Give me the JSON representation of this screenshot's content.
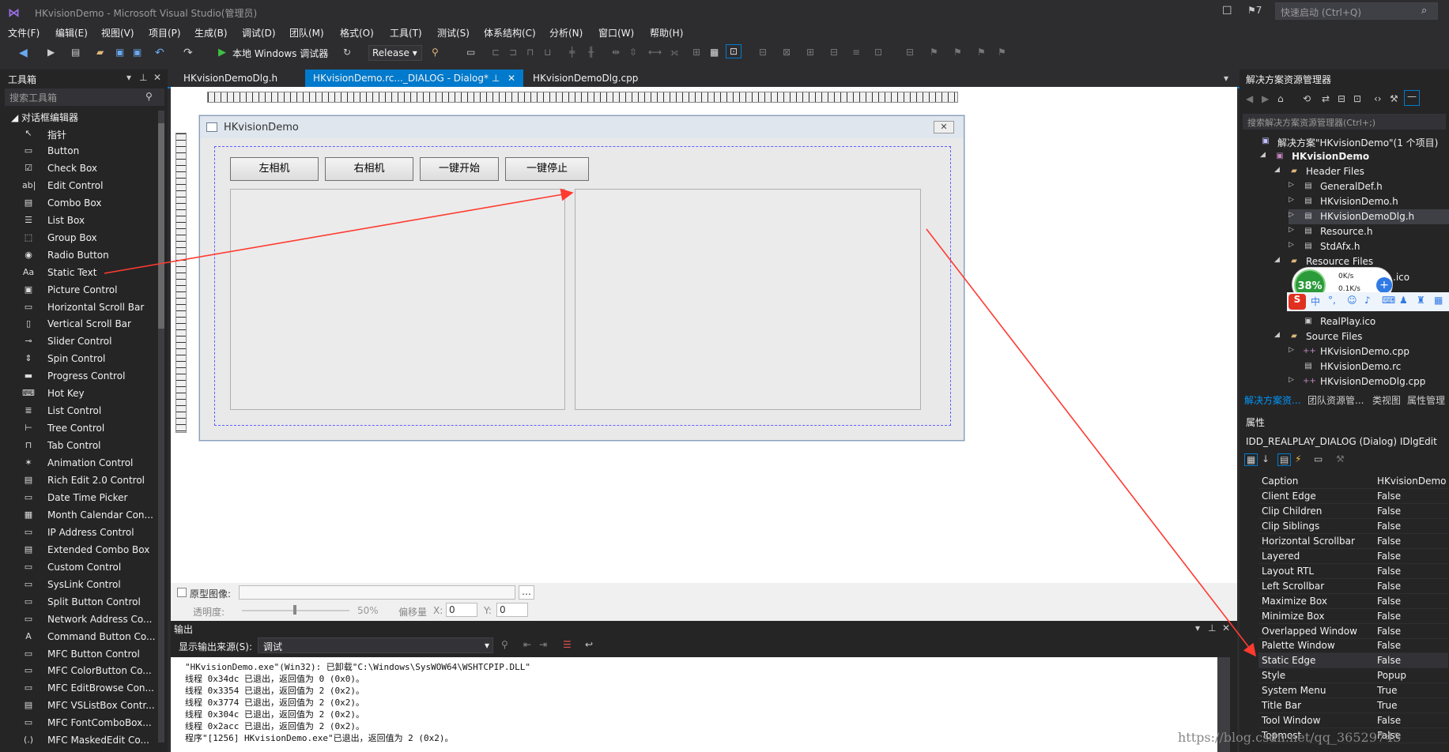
{
  "window": {
    "title": "HKvisionDemo - Microsoft Visual Studio(管理员)",
    "quick_launch": "快速启动 (Ctrl+Q)",
    "notif_count": "7"
  },
  "menu": [
    "文件(F)",
    "编辑(E)",
    "视图(V)",
    "项目(P)",
    "生成(B)",
    "调试(D)",
    "团队(M)",
    "格式(O)",
    "工具(T)",
    "测试(S)",
    "体系结构(C)",
    "分析(N)",
    "窗口(W)",
    "帮助(H)"
  ],
  "toolbar": {
    "debugger": "本地 Windows 调试器",
    "config": "Release"
  },
  "toolbox": {
    "title": "工具箱",
    "search_placeholder": "搜索工具箱",
    "group": "对话框编辑器",
    "items": [
      {
        "label": "指针",
        "icon": "pointer-icon",
        "glyph": "↖"
      },
      {
        "label": "Button",
        "icon": "button-icon",
        "glyph": "▭"
      },
      {
        "label": "Check Box",
        "icon": "checkbox-icon",
        "glyph": "☑"
      },
      {
        "label": "Edit Control",
        "icon": "edit-control-icon",
        "glyph": "ab|"
      },
      {
        "label": "Combo Box",
        "icon": "combobox-icon",
        "glyph": "▤"
      },
      {
        "label": "List Box",
        "icon": "listbox-icon",
        "glyph": "☰"
      },
      {
        "label": "Group Box",
        "icon": "groupbox-icon",
        "glyph": "⬚"
      },
      {
        "label": "Radio Button",
        "icon": "radio-icon",
        "glyph": "◉"
      },
      {
        "label": "Static Text",
        "icon": "static-text-icon",
        "glyph": "Aa"
      },
      {
        "label": "Picture Control",
        "icon": "picture-icon",
        "glyph": "▣"
      },
      {
        "label": "Horizontal Scroll Bar",
        "icon": "hscroll-icon",
        "glyph": "▭"
      },
      {
        "label": "Vertical Scroll Bar",
        "icon": "vscroll-icon",
        "glyph": "▯"
      },
      {
        "label": "Slider Control",
        "icon": "slider-icon",
        "glyph": "⊸"
      },
      {
        "label": "Spin Control",
        "icon": "spin-icon",
        "glyph": "⇕"
      },
      {
        "label": "Progress Control",
        "icon": "progress-icon",
        "glyph": "▬"
      },
      {
        "label": "Hot Key",
        "icon": "hotkey-icon",
        "glyph": "⌨"
      },
      {
        "label": "List Control",
        "icon": "listctrl-icon",
        "glyph": "≣"
      },
      {
        "label": "Tree Control",
        "icon": "tree-icon",
        "glyph": "⊢"
      },
      {
        "label": "Tab Control",
        "icon": "tab-icon",
        "glyph": "⊓"
      },
      {
        "label": "Animation Control",
        "icon": "animation-icon",
        "glyph": "✶"
      },
      {
        "label": "Rich Edit 2.0 Control",
        "icon": "richedit-icon",
        "glyph": "▤"
      },
      {
        "label": "Date Time Picker",
        "icon": "datetime-icon",
        "glyph": "▭"
      },
      {
        "label": "Month Calendar Con...",
        "icon": "calendar-icon",
        "glyph": "▦"
      },
      {
        "label": "IP Address Control",
        "icon": "ipaddr-icon",
        "glyph": "▭"
      },
      {
        "label": "Extended Combo Box",
        "icon": "extcombo-icon",
        "glyph": "▤"
      },
      {
        "label": "Custom Control",
        "icon": "custom-icon",
        "glyph": "▭"
      },
      {
        "label": "SysLink Control",
        "icon": "syslink-icon",
        "glyph": "▭"
      },
      {
        "label": "Split Button Control",
        "icon": "splitbutton-icon",
        "glyph": "▭"
      },
      {
        "label": "Network Address Co...",
        "icon": "netaddr-icon",
        "glyph": "▭"
      },
      {
        "label": "Command Button Co...",
        "icon": "command-icon",
        "glyph": "A"
      },
      {
        "label": "MFC Button Control",
        "icon": "mfcbutton-icon",
        "glyph": "▭"
      },
      {
        "label": "MFC ColorButton Co...",
        "icon": "colorbutton-icon",
        "glyph": "▭"
      },
      {
        "label": "MFC EditBrowse Con...",
        "icon": "editbrowse-icon",
        "glyph": "▭"
      },
      {
        "label": "MFC VSListBox Contr...",
        "icon": "vslistbox-icon",
        "glyph": "▤"
      },
      {
        "label": "MFC FontComboBox...",
        "icon": "fontcombo-icon",
        "glyph": "▭"
      },
      {
        "label": "MFC MaskedEdit Co...",
        "icon": "maskededit-icon",
        "glyph": "(.)"
      }
    ]
  },
  "tabs": [
    "HKvisionDemoDlg.h",
    "HKvisionDemo.rc..._DIALOG - Dialog*",
    "HKvisionDemoDlg.cpp"
  ],
  "dialog": {
    "caption": "HKvisionDemo",
    "buttons": [
      "左相机",
      "右相机",
      "一键开始",
      "一键停止"
    ]
  },
  "editbar": {
    "proto_label": "原型图像:",
    "opacity_label": "透明度:",
    "opacity_value": "50%",
    "offset_label": "偏移量",
    "x_label": "X:",
    "x_value": "0",
    "y_label": "Y:",
    "y_value": "0"
  },
  "output": {
    "title": "输出",
    "source_label": "显示输出来源(S):",
    "source_value": "调试",
    "lines": [
      "\"HKvisionDemo.exe\"(Win32): 已卸载\"C:\\Windows\\SysWOW64\\WSHTCPIP.DLL\"",
      "线程 0x34dc 已退出，返回值为 0 (0x0)。",
      "线程 0x3354 已退出，返回值为 2 (0x2)。",
      "线程 0x3774 已退出，返回值为 2 (0x2)。",
      "线程 0x304c 已退出，返回值为 2 (0x2)。",
      "线程 0x2acc 已退出，返回值为 2 (0x2)。",
      "程序\"[1256] HKvisionDemo.exe\"已退出，返回值为 2 (0x2)。"
    ]
  },
  "solution_explorer": {
    "title": "解决方案资源管理器",
    "search_placeholder": "搜索解决方案资源管理器(Ctrl+;)",
    "tree": [
      {
        "label": "解决方案\"HKvisionDemo\"(1 个项目)",
        "indent": 0,
        "arrow": "",
        "icon": "solution-icon",
        "glyph": "▣",
        "color": "#c0c0ff"
      },
      {
        "label": "HKvisionDemo",
        "indent": 1,
        "arrow": "◢",
        "icon": "project-icon",
        "glyph": "▣",
        "color": "#c586c0"
      },
      {
        "label": "Header Files",
        "indent": 2,
        "arrow": "◢",
        "icon": "folder-icon",
        "glyph": "▰",
        "color": "#dcb67a"
      },
      {
        "label": "GeneralDef.h",
        "indent": 3,
        "arrow": "▷",
        "icon": "header-file-icon",
        "glyph": "▤",
        "color": "#ccc"
      },
      {
        "label": "HKvisionDemo.h",
        "indent": 3,
        "arrow": "▷",
        "icon": "header-file-icon",
        "glyph": "▤",
        "color": "#ccc"
      },
      {
        "label": "HKvisionDemoDlg.h",
        "indent": 3,
        "arrow": "▷",
        "icon": "header-file-icon",
        "glyph": "▤",
        "color": "#ccc",
        "selected": true
      },
      {
        "label": "Resource.h",
        "indent": 3,
        "arrow": "▷",
        "icon": "header-file-icon",
        "glyph": "▤",
        "color": "#ccc"
      },
      {
        "label": "StdAfx.h",
        "indent": 3,
        "arrow": "▷",
        "icon": "header-file-icon",
        "glyph": "▤",
        "color": "#ccc"
      },
      {
        "label": "Resource Files",
        "indent": 2,
        "arrow": "◢",
        "icon": "folder-icon",
        "glyph": "▰",
        "color": "#dcb67a"
      },
      {
        "label": "",
        "indent": 3,
        "arrow": "",
        "icon": "",
        "glyph": "",
        "color": "#ccc"
      },
      {
        "label": "",
        "indent": 3,
        "arrow": "",
        "icon": "",
        "glyph": "",
        "color": "#ccc"
      },
      {
        "label": "",
        "indent": 3,
        "arrow": "",
        "icon": "",
        "glyph": "",
        "color": "#ccc"
      },
      {
        "label": "RealPlay.ico",
        "indent": 3,
        "arrow": "",
        "icon": "ico-file-icon",
        "glyph": "▣",
        "color": "#ccc"
      },
      {
        "label": "Source Files",
        "indent": 2,
        "arrow": "◢",
        "icon": "folder-icon",
        "glyph": "▰",
        "color": "#dcb67a"
      },
      {
        "label": "HKvisionDemo.cpp",
        "indent": 3,
        "arrow": "▷",
        "icon": "cpp-file-icon",
        "glyph": "++",
        "color": "#c586c0"
      },
      {
        "label": "HKvisionDemo.rc",
        "indent": 3,
        "arrow": "",
        "icon": "rc-file-icon",
        "glyph": "▤",
        "color": "#ccc"
      },
      {
        "label": "HKvisionDemoDlg.cpp",
        "indent": 3,
        "arrow": "▷",
        "icon": "cpp-file-icon",
        "glyph": "++",
        "color": "#c586c0"
      }
    ],
    "ico_suffix": ".ico",
    "bottom_tabs": [
      "解决方案资...",
      "团队资源管...",
      "类视图",
      "属性管理"
    ]
  },
  "properties": {
    "title": "属性",
    "object": "IDD_REALPLAY_DIALOG (Dialog)  IDlgEdit",
    "rows": [
      {
        "k": "Caption",
        "v": "HKvisionDemo"
      },
      {
        "k": "Client Edge",
        "v": "False"
      },
      {
        "k": "Clip Children",
        "v": "False"
      },
      {
        "k": "Clip Siblings",
        "v": "False"
      },
      {
        "k": "Horizontal Scrollbar",
        "v": "False"
      },
      {
        "k": "Layered",
        "v": "False"
      },
      {
        "k": "Layout RTL",
        "v": "False"
      },
      {
        "k": "Left Scrollbar",
        "v": "False"
      },
      {
        "k": "Maximize Box",
        "v": "False"
      },
      {
        "k": "Minimize Box",
        "v": "False"
      },
      {
        "k": "Overlapped Window",
        "v": "False"
      },
      {
        "k": "Palette Window",
        "v": "False"
      },
      {
        "k": "Static Edge",
        "v": "False",
        "selected": true
      },
      {
        "k": "Style",
        "v": "Popup"
      },
      {
        "k": "System Menu",
        "v": "True"
      },
      {
        "k": "Title Bar",
        "v": "True"
      },
      {
        "k": "Tool Window",
        "v": "False"
      },
      {
        "k": "Topmost",
        "v": "False"
      }
    ]
  },
  "net_widget": {
    "percent": "38%",
    "up": "0K/s",
    "down": "0.1K/s"
  },
  "watermark": "https://blog.csdn.net/qq_36529743",
  "colors": {
    "accent": "#007acc",
    "arrow": "#ff3b30"
  }
}
